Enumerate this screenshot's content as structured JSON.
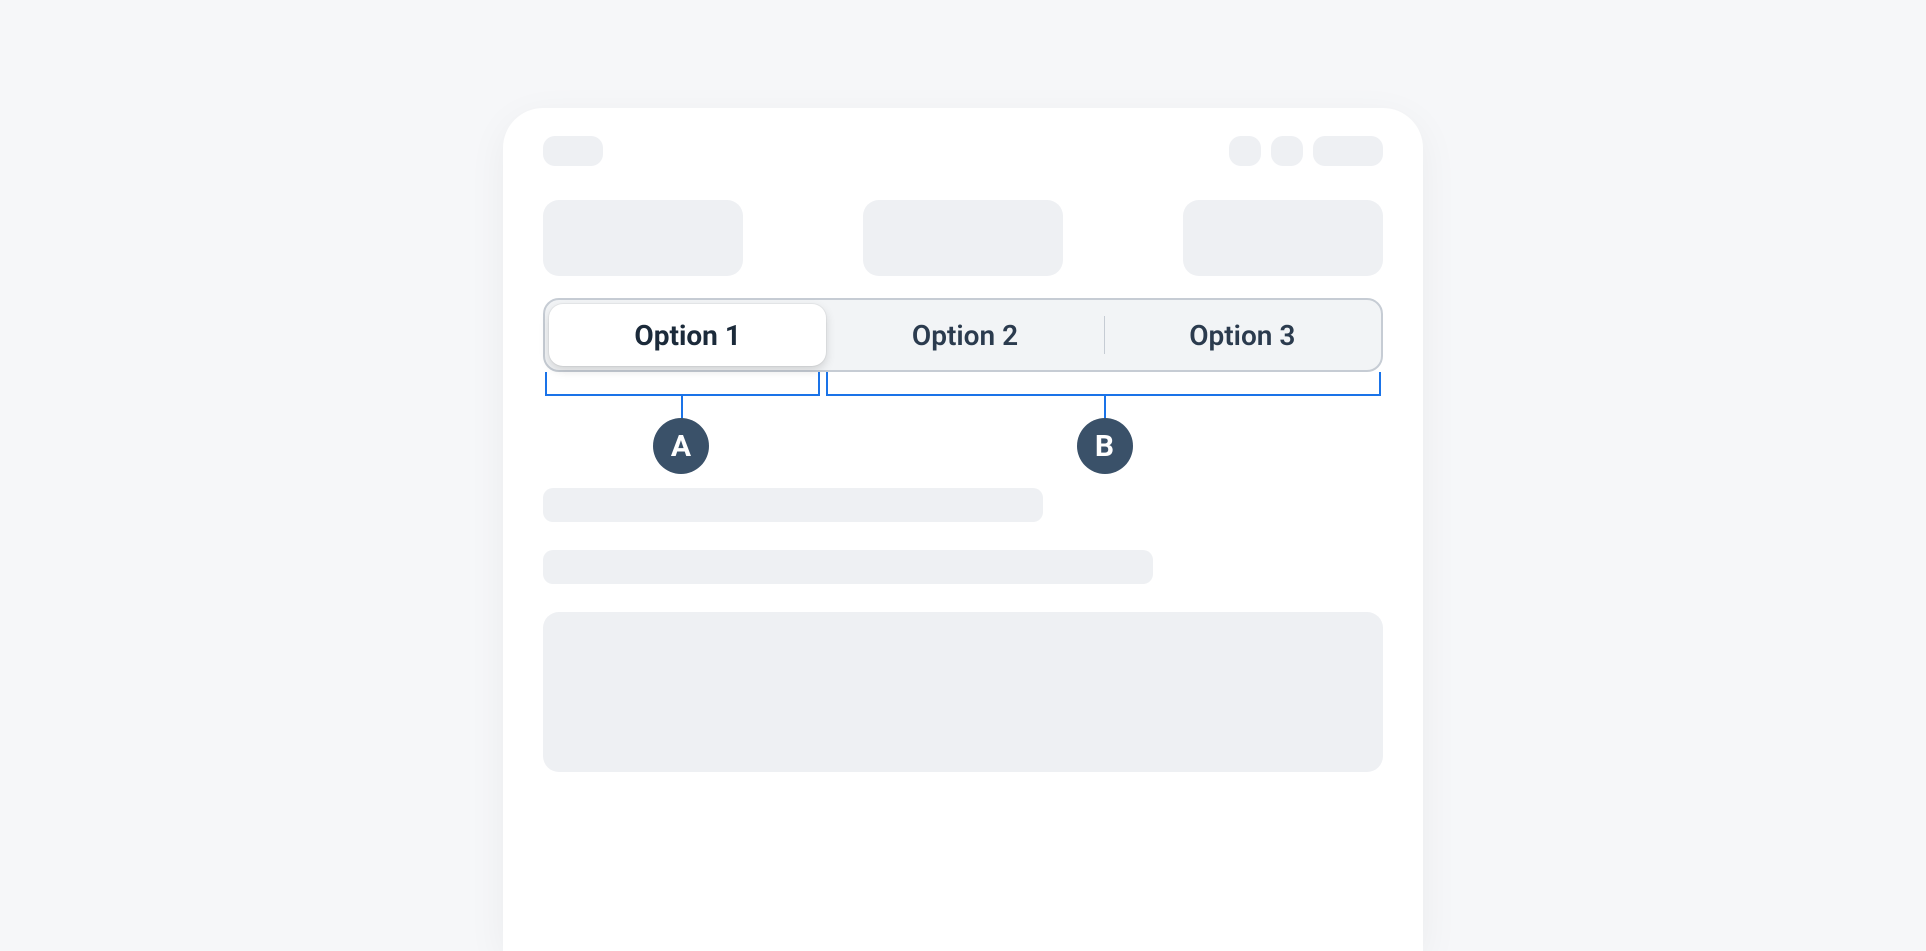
{
  "segmented": {
    "options": [
      {
        "label": "Option 1",
        "selected": true
      },
      {
        "label": "Option 2",
        "selected": false
      },
      {
        "label": "Option 3",
        "selected": false
      }
    ]
  },
  "annotations": {
    "a": "A",
    "b": "B"
  },
  "colors": {
    "accent": "#1a73e8",
    "badge_bg": "#3a5169",
    "placeholder": "#eef0f3"
  }
}
